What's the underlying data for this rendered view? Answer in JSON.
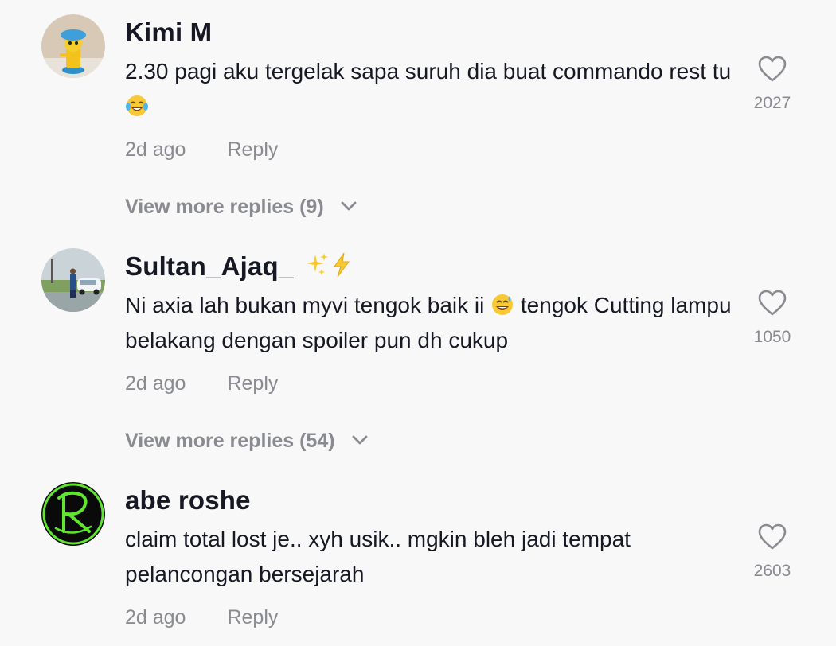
{
  "comments": [
    {
      "username": "Kimi M",
      "username_emoji": "",
      "text_before_emoji": "2.30 pagi aku tergelak sapa suruh dia buat commando rest tu",
      "emoji": "face-with-tears-of-joy",
      "text_after_emoji": "",
      "time": "2d ago",
      "reply_label": "Reply",
      "likes": "2027",
      "view_more": "View more replies (9)",
      "avatar": "avatar-toy-figure"
    },
    {
      "username": "Sultan_Ajaq_",
      "username_emoji": "sparkles-lightning",
      "text_before_emoji": "Ni axia lah bukan myvi tengok baik ii",
      "emoji": "grinning-face-with-sweat",
      "text_after_emoji": "tengok Cutting lampu belakang dengan spoiler pun dh cukup",
      "time": "2d ago",
      "reply_label": "Reply",
      "likes": "1050",
      "view_more": "View more replies (54)",
      "avatar": "avatar-car-photo"
    },
    {
      "username": "abe roshe",
      "username_emoji": "",
      "text_before_emoji": "claim total lost je.. xyh usik.. mgkin bleh jadi tempat pelancongan bersejarah",
      "emoji": "",
      "text_after_emoji": "",
      "time": "2d ago",
      "reply_label": "Reply",
      "likes": "2603",
      "view_more": "",
      "avatar": "avatar-green-r-logo"
    }
  ],
  "colors": {
    "background": "#f8f8f8",
    "text": "#161823",
    "secondary": "#8a8b91",
    "logo_green": "#5fe62e"
  }
}
